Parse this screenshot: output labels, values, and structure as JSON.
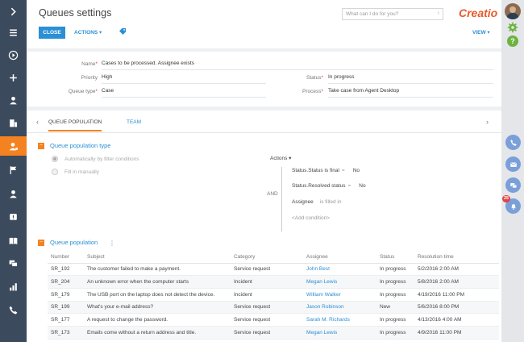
{
  "page": {
    "title": "Queues settings",
    "search_placeholder": "What can I do for you?",
    "logo": "Creatio"
  },
  "toolbar": {
    "close_label": "CLOSE",
    "actions_label": "ACTIONS ▾",
    "view_label": "VIEW ▾"
  },
  "fields": {
    "name": {
      "label": "Name",
      "value": "Cases to be processed. Assignee exists"
    },
    "priority": {
      "label": "Priority",
      "value": "High"
    },
    "queue_type": {
      "label": "Queue type",
      "value": "Case"
    },
    "status": {
      "label": "Status",
      "value": "In progress"
    },
    "process": {
      "label": "Process",
      "value": "Take case from Agent Desktop"
    }
  },
  "tabs": {
    "queue_population": "QUEUE POPULATION",
    "team": "TEAM"
  },
  "population_type": {
    "title": "Queue population type",
    "option_filter": "Automatically by filter conditions",
    "option_manual": "Fill in manually",
    "selected": "Automatically by filter conditions"
  },
  "filter": {
    "actions_label": "Actions ▾",
    "logic": "AND",
    "conditions": [
      {
        "column": "Status.Status is final",
        "op": "=",
        "value": "No"
      },
      {
        "column": "Status.Resolved status",
        "op": "=",
        "value": "No"
      },
      {
        "column": "Assignee",
        "op": "is filled in",
        "value": ""
      }
    ],
    "add_label": "<Add condition>"
  },
  "population": {
    "title": "Queue population",
    "columns": [
      "Number",
      "Subject",
      "Category",
      "Assignee",
      "Status",
      "Resolution time"
    ],
    "rows": [
      [
        "SR_192",
        "The customer failed to make a payment.",
        "Service request",
        "John Best",
        "In progress",
        "5/2/2016 2:00 AM"
      ],
      [
        "SR_204",
        "An unknown error when the computer starts",
        "Incident",
        "Megan Lewis",
        "In progress",
        "5/8/2016 2:00 AM"
      ],
      [
        "SR_179",
        "The USB port on the laptop does not detect the device.",
        "Incident",
        "William Walker",
        "In progress",
        "4/19/2016 11:00 PM"
      ],
      [
        "SR_199",
        "What's your e-mail address?",
        "Service request",
        "Jason Robinson",
        "New",
        "5/6/2016 8:00 PM"
      ],
      [
        "SR_177",
        "A request to change the password.",
        "Service request",
        "Sarah M. Richards",
        "In progress",
        "4/13/2016 4:00 AM"
      ],
      [
        "SR_173",
        "Emails come without a return address and title.",
        "Service request",
        "Megan Lewis",
        "In progress",
        "4/9/2016 11:00 PM"
      ]
    ]
  },
  "notifications": {
    "badge_count": "25"
  },
  "colors": {
    "accent": "#f58220",
    "link": "#2a8fd4",
    "sidebar": "#3b4a5c",
    "brand": "#e85a2b"
  }
}
